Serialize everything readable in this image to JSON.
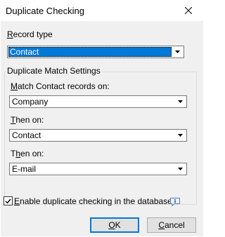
{
  "window": {
    "title": "Duplicate Checking"
  },
  "record_type": {
    "mnemonic": "R",
    "label_rest": "ecord type",
    "value": "Contact"
  },
  "group": {
    "legend": "Duplicate Match Settings",
    "match_on": {
      "mnemonic": "M",
      "label_rest": "atch Contact records on:",
      "value": "Company"
    },
    "then_on_1": {
      "pre": "",
      "mnemonic": "T",
      "label_rest": "hen on:",
      "value": "Contact"
    },
    "then_on_2": {
      "pre": "T",
      "mnemonic": "h",
      "label_rest": "en on:",
      "value": "E-mail"
    }
  },
  "enable_checkbox": {
    "mnemonic": "E",
    "label_rest": "nable duplicate checking in the database",
    "checked": true
  },
  "buttons": {
    "ok": {
      "mnemonic": "O",
      "rest": "K"
    },
    "cancel": {
      "mnemonic": "C",
      "rest": "ancel"
    }
  },
  "icons": {
    "close": "close-icon",
    "dropdown": "chevron-down-icon",
    "info": "info-icon",
    "check": "check-icon"
  },
  "colors": {
    "selection": "#0078d7",
    "dialog_bg": "#f0f0f0",
    "button_bg": "#e1e1e1"
  }
}
